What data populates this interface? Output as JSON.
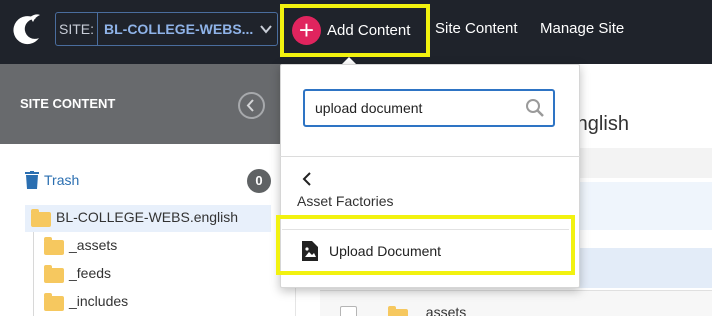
{
  "topbar": {
    "site_label": "SITE:",
    "site_value": "BL-COLLEGE-WEBS.... ",
    "add_content_label": "Add Content",
    "nav": [
      "Site Content",
      "Manage Site"
    ]
  },
  "sidebar": {
    "title": "SITE CONTENT",
    "trash_label": "Trash",
    "trash_count": "0",
    "root_item": "BL-COLLEGE-WEBS.english",
    "children": [
      "_assets",
      "_feeds",
      "_includes"
    ]
  },
  "main": {
    "title_fragment": ".english",
    "row_fragment": "_assets"
  },
  "dropdown": {
    "search_value": "upload document",
    "section_label": "Asset Factories",
    "item_label": "Upload Document"
  },
  "colors": {
    "topbar": "#1f232b",
    "accent_highlight": "#f2f20f",
    "add_button": "#e0245e",
    "link": "#2b6fb1"
  }
}
